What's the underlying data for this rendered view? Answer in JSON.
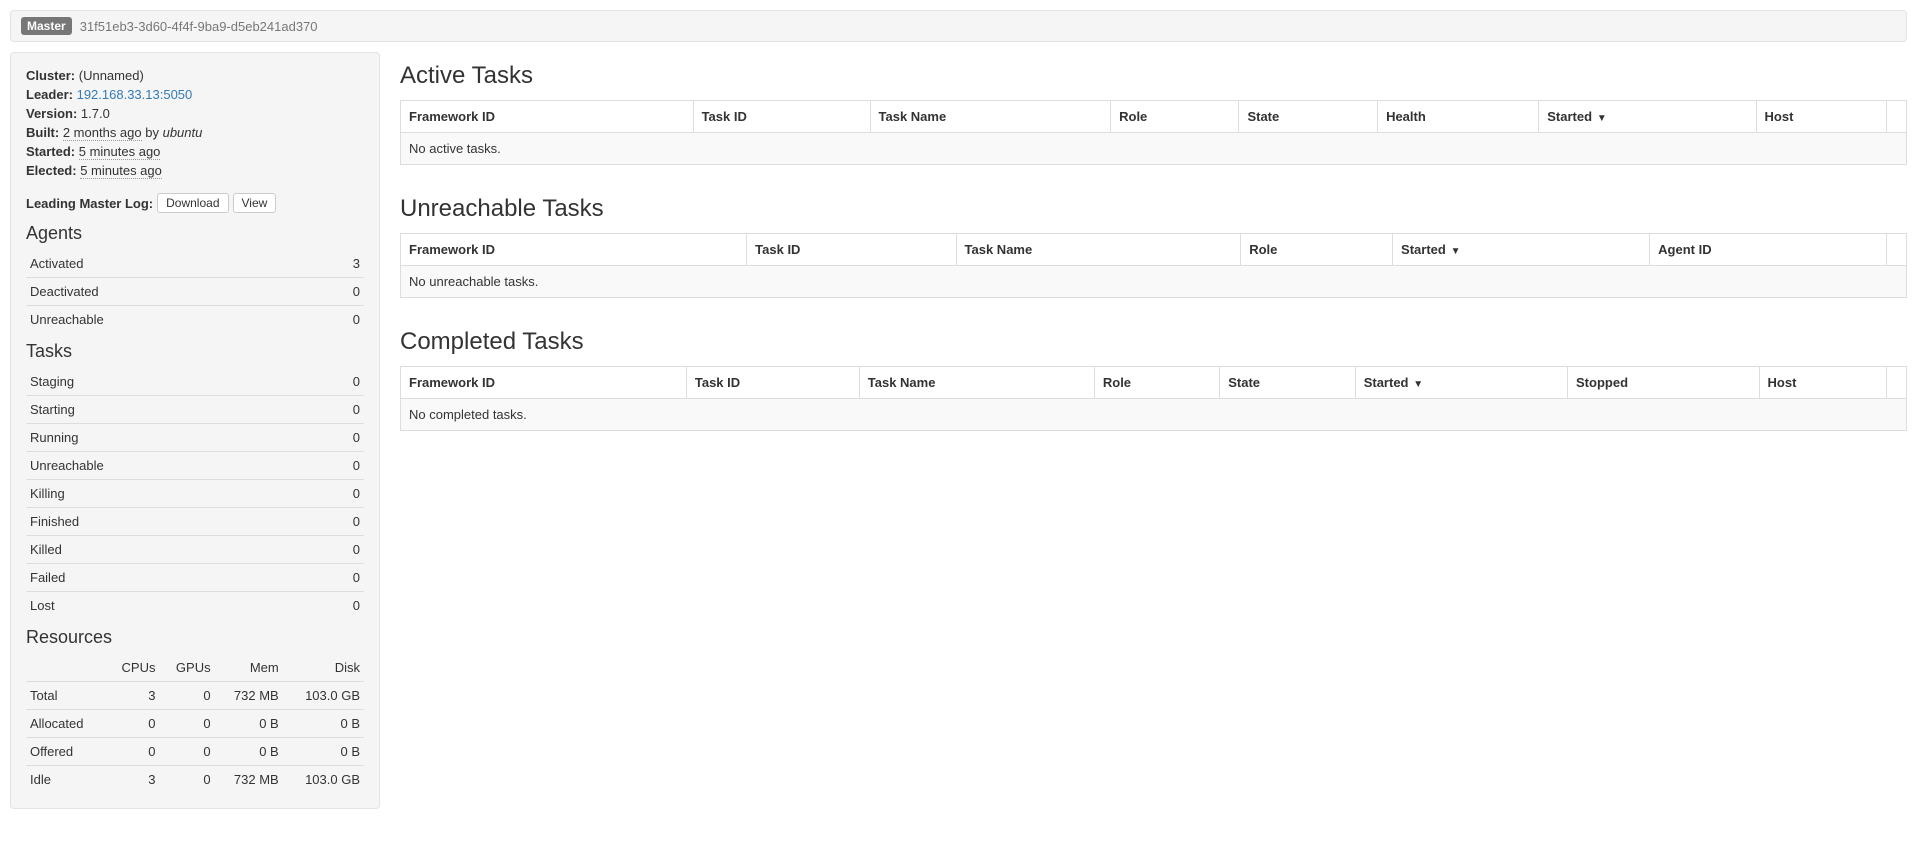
{
  "header": {
    "badge": "Master",
    "master_id": "31f51eb3-3d60-4f4f-9ba9-d5eb241ad370"
  },
  "cluster_info": {
    "cluster_label": "Cluster:",
    "cluster_value": "(Unnamed)",
    "leader_label": "Leader:",
    "leader_value": "192.168.33.13:5050",
    "version_label": "Version:",
    "version_value": "1.7.0",
    "built_label": "Built:",
    "built_time": "2 months ago",
    "built_by_text": " by ",
    "built_user": "ubuntu",
    "started_label": "Started:",
    "started_value": "5 minutes ago",
    "elected_label": "Elected:",
    "elected_value": "5 minutes ago"
  },
  "log": {
    "label": "Leading Master Log:",
    "download": "Download",
    "view": "View"
  },
  "agents": {
    "title": "Agents",
    "rows": [
      {
        "label": "Activated",
        "value": "3"
      },
      {
        "label": "Deactivated",
        "value": "0"
      },
      {
        "label": "Unreachable",
        "value": "0"
      }
    ]
  },
  "tasks": {
    "title": "Tasks",
    "rows": [
      {
        "label": "Staging",
        "value": "0"
      },
      {
        "label": "Starting",
        "value": "0"
      },
      {
        "label": "Running",
        "value": "0"
      },
      {
        "label": "Unreachable",
        "value": "0"
      },
      {
        "label": "Killing",
        "value": "0"
      },
      {
        "label": "Finished",
        "value": "0"
      },
      {
        "label": "Killed",
        "value": "0"
      },
      {
        "label": "Failed",
        "value": "0"
      },
      {
        "label": "Lost",
        "value": "0"
      }
    ]
  },
  "resources": {
    "title": "Resources",
    "headers": [
      "",
      "CPUs",
      "GPUs",
      "Mem",
      "Disk"
    ],
    "rows": [
      {
        "label": "Total",
        "cpus": "3",
        "gpus": "0",
        "mem": "732 MB",
        "disk": "103.0 GB"
      },
      {
        "label": "Allocated",
        "cpus": "0",
        "gpus": "0",
        "mem": "0 B",
        "disk": "0 B"
      },
      {
        "label": "Offered",
        "cpus": "0",
        "gpus": "0",
        "mem": "0 B",
        "disk": "0 B"
      },
      {
        "label": "Idle",
        "cpus": "3",
        "gpus": "0",
        "mem": "732 MB",
        "disk": "103.0 GB"
      }
    ]
  },
  "active_tasks": {
    "title": "Active Tasks",
    "columns": [
      "Framework ID",
      "Task ID",
      "Task Name",
      "Role",
      "State",
      "Health",
      "Started",
      "Host"
    ],
    "sort_indicator": "▼",
    "sort_col_index": 6,
    "empty": "No active tasks."
  },
  "unreachable_tasks": {
    "title": "Unreachable Tasks",
    "columns": [
      "Framework ID",
      "Task ID",
      "Task Name",
      "Role",
      "Started",
      "Agent ID"
    ],
    "sort_indicator": "▼",
    "sort_col_index": 4,
    "empty": "No unreachable tasks."
  },
  "completed_tasks": {
    "title": "Completed Tasks",
    "columns": [
      "Framework ID",
      "Task ID",
      "Task Name",
      "Role",
      "State",
      "Started",
      "Stopped",
      "Host"
    ],
    "sort_indicator": "▼",
    "sort_col_index": 5,
    "empty": "No completed tasks."
  }
}
